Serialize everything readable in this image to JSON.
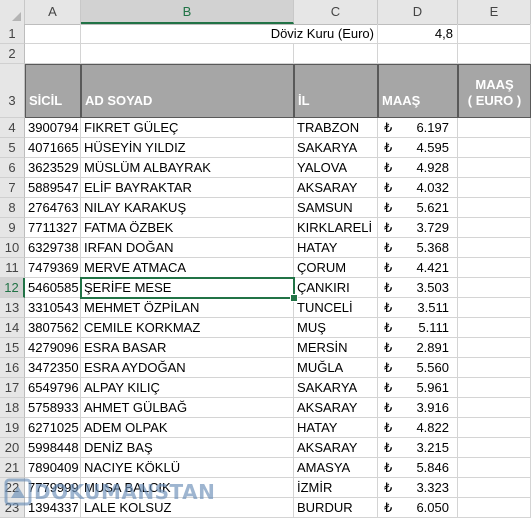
{
  "columns": [
    "A",
    "B",
    "C",
    "D",
    "E"
  ],
  "row1": {
    "row_num": "1",
    "label": "Döviz Kuru (Euro)",
    "value": "4,8"
  },
  "row2": {
    "row_num": "2"
  },
  "header": {
    "row_num": "3",
    "sicil": "SİCİL",
    "ad_soyad": "AD SOYAD",
    "il": "İL",
    "maas": "MAAŞ",
    "maas_euro_1": "MAAŞ",
    "maas_euro_2": "( EURO )"
  },
  "currency_symbol": "₺",
  "rows": [
    {
      "n": "4",
      "sicil": "3900794",
      "name": "FIKRET GÜLEÇ",
      "il": "TRABZON",
      "maas": "6.197"
    },
    {
      "n": "5",
      "sicil": "4071665",
      "name": "HÜSEYİN YILDIZ",
      "il": "SAKARYA",
      "maas": "4.595"
    },
    {
      "n": "6",
      "sicil": "3623529",
      "name": "MÜSLÜM ALBAYRAK",
      "il": "YALOVA",
      "maas": "4.928"
    },
    {
      "n": "7",
      "sicil": "5889547",
      "name": "ELİF BAYRAKTAR",
      "il": "AKSARAY",
      "maas": "4.032"
    },
    {
      "n": "8",
      "sicil": "2764763",
      "name": "NILAY KARAKUŞ",
      "il": "SAMSUN",
      "maas": "5.621"
    },
    {
      "n": "9",
      "sicil": "7711327",
      "name": "FATMA ÖZBEK",
      "il": "KIRKLARELİ",
      "maas": "3.729"
    },
    {
      "n": "10",
      "sicil": "6329738",
      "name": "IRFAN DOĞAN",
      "il": "HATAY",
      "maas": "5.368"
    },
    {
      "n": "11",
      "sicil": "7479369",
      "name": "MERVE ATMACA",
      "il": "ÇORUM",
      "maas": "4.421"
    },
    {
      "n": "12",
      "sicil": "5460585",
      "name": "ŞERİFE MESE",
      "il": "ÇANKIRI",
      "maas": "3.503"
    },
    {
      "n": "13",
      "sicil": "3310543",
      "name": "MEHMET ÖZPİLAN",
      "il": "TUNCELİ",
      "maas": "3.511"
    },
    {
      "n": "14",
      "sicil": "3807562",
      "name": "CEMILE KORKMAZ",
      "il": "MUŞ",
      "maas": "5.111"
    },
    {
      "n": "15",
      "sicil": "4279096",
      "name": "ESRA BASAR",
      "il": "MERSİN",
      "maas": "2.891"
    },
    {
      "n": "16",
      "sicil": "3472350",
      "name": "ESRA AYDOĞAN",
      "il": "MUĞLA",
      "maas": "5.560"
    },
    {
      "n": "17",
      "sicil": "6549796",
      "name": "ALPAY KILIÇ",
      "il": "SAKARYA",
      "maas": "5.961"
    },
    {
      "n": "18",
      "sicil": "5758933",
      "name": "AHMET GÜLBAĞ",
      "il": "AKSARAY",
      "maas": "3.916"
    },
    {
      "n": "19",
      "sicil": "6271025",
      "name": "ADEM OLPAK",
      "il": "HATAY",
      "maas": "4.822"
    },
    {
      "n": "20",
      "sicil": "5998448",
      "name": "DENİZ BAŞ",
      "il": "AKSARAY",
      "maas": "3.215"
    },
    {
      "n": "21",
      "sicil": "7890409",
      "name": "NACIYE KÖKLÜ",
      "il": "AMASYA",
      "maas": "5.846"
    },
    {
      "n": "22",
      "sicil": "7779999",
      "name": "MUSA BALCIK",
      "il": "İZMİR",
      "maas": "3.323"
    },
    {
      "n": "23",
      "sicil": "1394337",
      "name": "LALE KOLSUZ",
      "il": "BURDUR",
      "maas": "6.050"
    }
  ],
  "selected_cell": "B12",
  "watermark": "DOKUMANSTAN",
  "colors": {
    "header_fill": "#a6a6a6",
    "accent": "#217346"
  }
}
